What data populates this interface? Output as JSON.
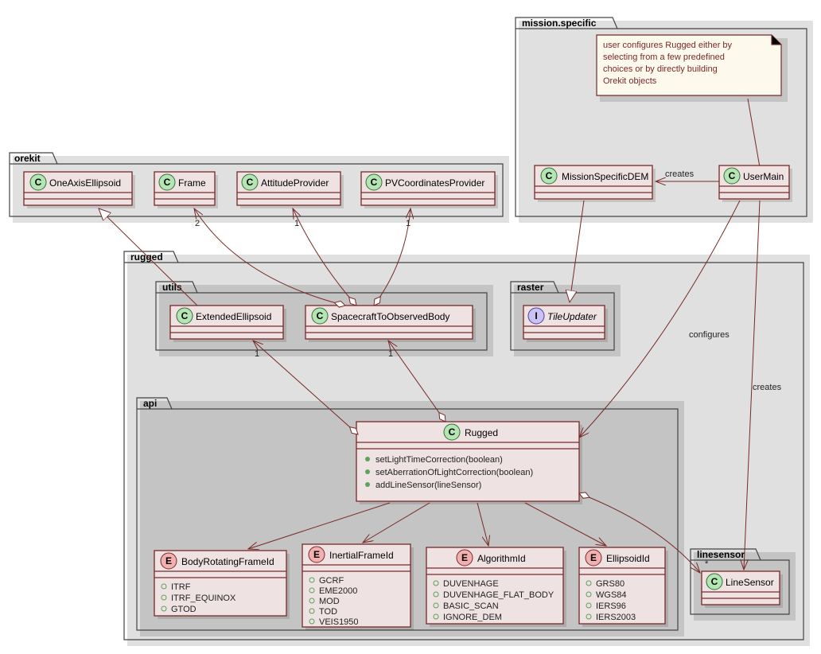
{
  "packages": {
    "orekit": "orekit",
    "mission": "mission.specific",
    "rugged": "rugged",
    "utils": "utils",
    "raster": "raster",
    "api": "api",
    "linesensor": "linesensor"
  },
  "classes": {
    "OneAxisEllipsoid": {
      "name": "OneAxisEllipsoid",
      "stereo": "C"
    },
    "Frame": {
      "name": "Frame",
      "stereo": "C"
    },
    "AttitudeProvider": {
      "name": "AttitudeProvider",
      "stereo": "C"
    },
    "PVCoordinatesProvider": {
      "name": "PVCoordinatesProvider",
      "stereo": "C"
    },
    "MissionSpecificDEM": {
      "name": "MissionSpecificDEM",
      "stereo": "C"
    },
    "UserMain": {
      "name": "UserMain",
      "stereo": "C"
    },
    "ExtendedEllipsoid": {
      "name": "ExtendedEllipsoid",
      "stereo": "C"
    },
    "SpacecraftToObservedBody": {
      "name": "SpacecraftToObservedBody",
      "stereo": "C"
    },
    "TileUpdater": {
      "name": "TileUpdater",
      "stereo": "I",
      "italic": true
    },
    "Rugged": {
      "name": "Rugged",
      "stereo": "C",
      "methods": [
        "setLightTimeCorrection(boolean)",
        "setAberrationOfLightCorrection(boolean)",
        "addLineSensor(lineSensor)"
      ]
    },
    "BodyRotatingFrameId": {
      "name": "BodyRotatingFrameId",
      "stereo": "E",
      "values": [
        "ITRF",
        "ITRF_EQUINOX",
        "GTOD"
      ]
    },
    "InertialFrameId": {
      "name": "InertialFrameId",
      "stereo": "E",
      "values": [
        "GCRF",
        "EME2000",
        "MOD",
        "TOD",
        "VEIS1950"
      ]
    },
    "AlgorithmId": {
      "name": "AlgorithmId",
      "stereo": "E",
      "values": [
        "DUVENHAGE",
        "DUVENHAGE_FLAT_BODY",
        "BASIC_SCAN",
        "IGNORE_DEM"
      ]
    },
    "EllipsoidId": {
      "name": "EllipsoidId",
      "stereo": "E",
      "values": [
        "GRS80",
        "WGS84",
        "IERS96",
        "IERS2003"
      ]
    },
    "LineSensor": {
      "name": "LineSensor",
      "stereo": "C"
    }
  },
  "note": {
    "lines": [
      "user configures Rugged either by",
      "selecting from a few predefined",
      "choices or by directly building",
      "Orekit objects"
    ]
  },
  "labels": {
    "creates": "creates",
    "configures": "configures"
  },
  "mults": {
    "one": "1",
    "two": "2",
    "star": "*"
  }
}
